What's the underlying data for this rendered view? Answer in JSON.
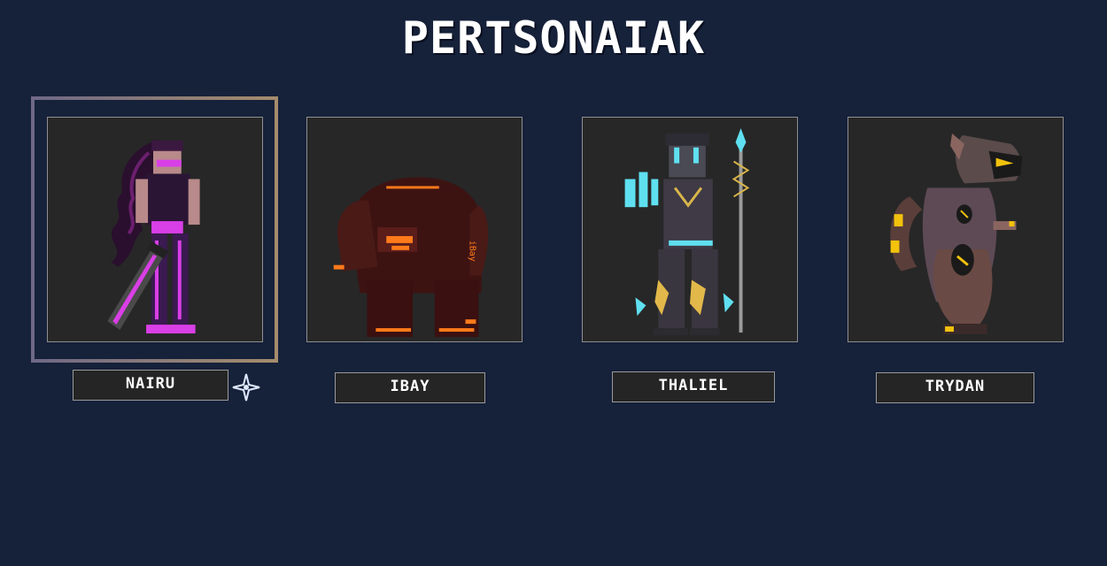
{
  "page_title": "PERTSONAIAK",
  "selected_character": "NAIRU",
  "characters": [
    {
      "name": "NAIRU",
      "accent": "#d93fe6",
      "selected": true
    },
    {
      "name": "IBAY",
      "accent": "#ff7a1a",
      "selected": false
    },
    {
      "name": "THALIEL",
      "accent": "#5fe0f0",
      "selected": false
    },
    {
      "name": "TRYDAN",
      "accent": "#f2c20d",
      "selected": false
    }
  ],
  "colors": {
    "background": "#16213a",
    "card_background": "#272727",
    "selection_border_start": "#6f6986",
    "selection_border_end": "#a58c6c"
  },
  "icons": {
    "selected_marker": "sparkle-icon"
  }
}
